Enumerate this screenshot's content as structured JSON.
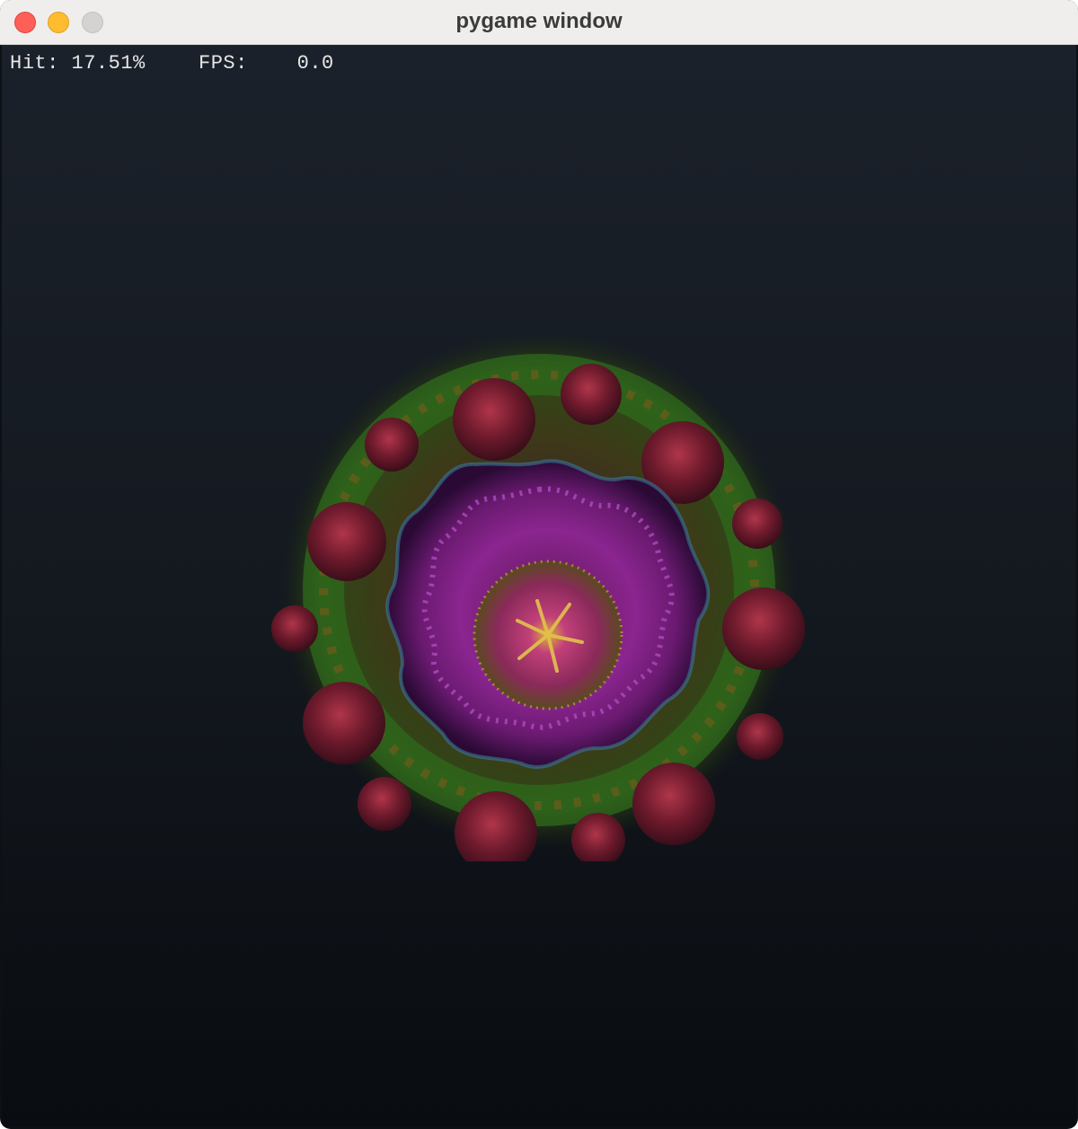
{
  "window": {
    "title": "pygame window"
  },
  "hud": {
    "hit_label": "Hit:",
    "hit_value": "17.51%",
    "fps_label": "FPS:",
    "fps_value": "0.0"
  },
  "scene": {
    "description_icon": "fractal-render",
    "colors": {
      "background_top": "#1b212a",
      "background_bottom": "#090c10",
      "outer_ring": "#6b1a2a",
      "foliage": "#2f5a1a",
      "inner_ring": "#8a1f8e",
      "core": "#b8326e"
    }
  }
}
